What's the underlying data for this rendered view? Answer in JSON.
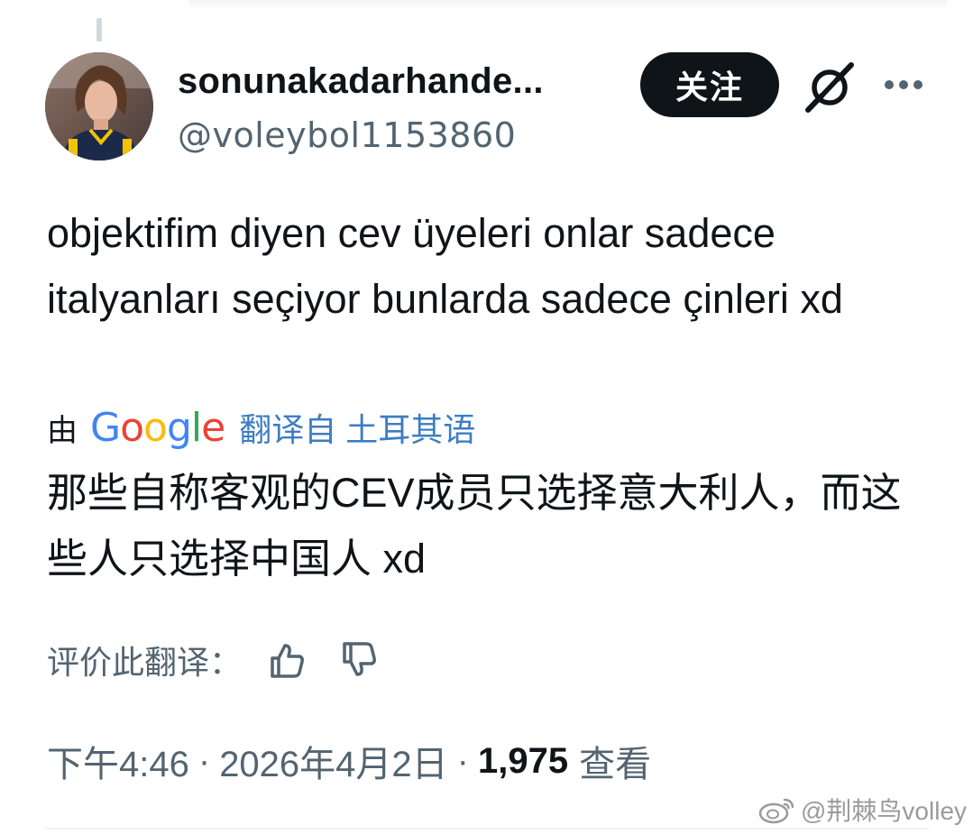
{
  "author": {
    "display_name": "sonunakadarhande...",
    "handle": "@voleybol1153860"
  },
  "actions": {
    "follow_label": "关注",
    "grok_icon": "grok-icon",
    "more_icon": "more-icon"
  },
  "tweet": {
    "text": "objektifim diyen cev üyeleri onlar sadece italyanları seçiyor bunlarda sadece çinleri xd"
  },
  "translation": {
    "by_label": "由",
    "provider": "Google",
    "link_label": "翻译自 土耳其语",
    "text": "那些自称客观的CEV成员只选择意大利人，而这些人只选择中国人 xd",
    "rate_label": "评价此翻译：",
    "link_color": "#3d7dc4"
  },
  "meta": {
    "time": "下午4:46",
    "separator": "·",
    "date": "2026年4月2日",
    "views_count": "1,975",
    "views_label": "查看"
  },
  "watermark": {
    "text": "@荆棘鸟volley"
  },
  "colors": {
    "text_primary": "#0f1419",
    "text_secondary": "#536471",
    "follow_bg": "#0f1419"
  }
}
